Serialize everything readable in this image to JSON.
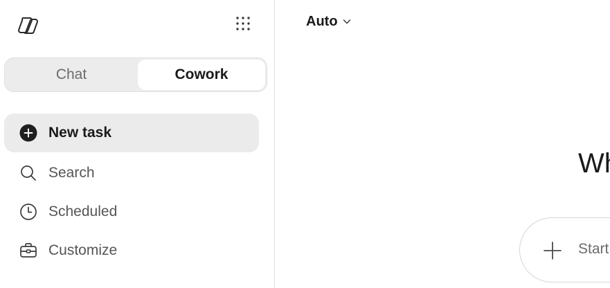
{
  "sidebar": {
    "logo_icon": "copilot-logo-icon",
    "apps_icon": "app-grid-icon",
    "mode_tabs": [
      {
        "label": "Chat",
        "selected": false
      },
      {
        "label": "Cowork",
        "selected": true
      }
    ],
    "nav": [
      {
        "label": "New task",
        "icon": "plus-circle-icon",
        "active": true
      },
      {
        "label": "Search",
        "icon": "search-icon",
        "active": false
      },
      {
        "label": "Scheduled",
        "icon": "clock-icon",
        "active": false
      },
      {
        "label": "Customize",
        "icon": "briefcase-icon",
        "active": false
      }
    ]
  },
  "main": {
    "model_selector": {
      "label": "Auto",
      "icon": "chevron-down-icon"
    },
    "greeting": "Wh",
    "composer": {
      "add_icon": "plus-icon",
      "placeholder": "Start"
    }
  },
  "colors": {
    "active_bg": "#ebebeb",
    "segment_bg": "#ececec",
    "text_primary": "#1a1a1a",
    "text_secondary": "#555555",
    "border": "#e1e1e1"
  }
}
